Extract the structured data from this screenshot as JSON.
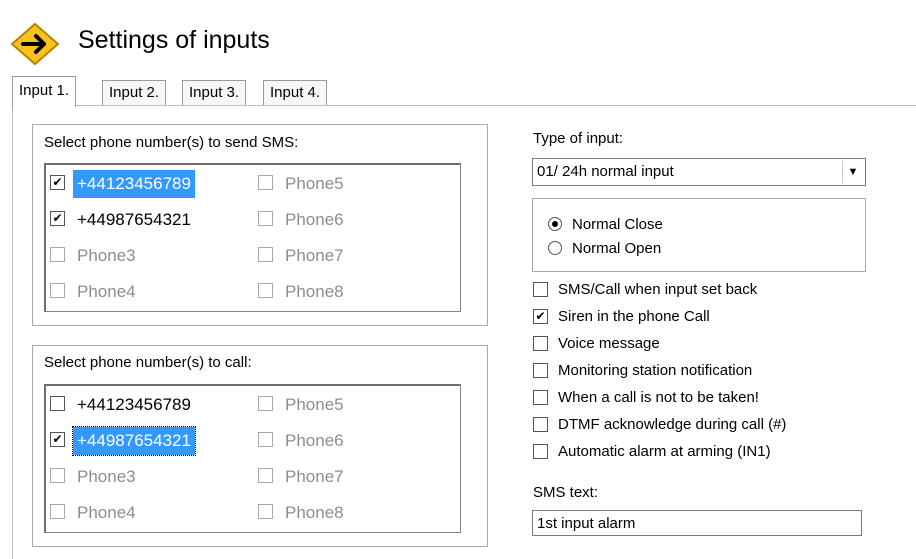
{
  "header": {
    "title": "Settings of inputs",
    "icon": "arrow-right-icon"
  },
  "tabs": [
    {
      "label": "Input 1.",
      "active": true
    },
    {
      "label": "Input 2.",
      "active": false
    },
    {
      "label": "Input 3.",
      "active": false
    },
    {
      "label": "Input 4.",
      "active": false
    }
  ],
  "sms_group": {
    "label": "Select phone number(s) to send SMS:",
    "items": [
      {
        "label": "+44123456789",
        "checked": true,
        "enabled": true,
        "selected": true
      },
      {
        "label": "+44987654321",
        "checked": true,
        "enabled": true
      },
      {
        "label": "Phone3",
        "checked": false,
        "enabled": false
      },
      {
        "label": "Phone4",
        "checked": false,
        "enabled": false
      },
      {
        "label": "Phone5",
        "checked": false,
        "enabled": false
      },
      {
        "label": "Phone6",
        "checked": false,
        "enabled": false
      },
      {
        "label": "Phone7",
        "checked": false,
        "enabled": false
      },
      {
        "label": "Phone8",
        "checked": false,
        "enabled": false
      }
    ]
  },
  "call_group": {
    "label": "Select phone number(s) to call:",
    "items": [
      {
        "label": "+44123456789",
        "checked": false,
        "enabled": true
      },
      {
        "label": "+44987654321",
        "checked": true,
        "enabled": true,
        "selected": true
      },
      {
        "label": "Phone3",
        "checked": false,
        "enabled": false
      },
      {
        "label": "Phone4",
        "checked": false,
        "enabled": false
      },
      {
        "label": "Phone5",
        "checked": false,
        "enabled": false
      },
      {
        "label": "Phone6",
        "checked": false,
        "enabled": false
      },
      {
        "label": "Phone7",
        "checked": false,
        "enabled": false
      },
      {
        "label": "Phone8",
        "checked": false,
        "enabled": false
      }
    ]
  },
  "type_of_input": {
    "label": "Type of input:",
    "value": "01/ 24h normal input",
    "radios": [
      {
        "label": "Normal Close",
        "checked": true
      },
      {
        "label": "Normal Open",
        "checked": false
      }
    ]
  },
  "options": [
    {
      "label": "SMS/Call when input set back",
      "checked": false
    },
    {
      "label": "Siren in the phone Call",
      "checked": true
    },
    {
      "label": "Voice message",
      "checked": false
    },
    {
      "label": "Monitoring station notification",
      "checked": false
    },
    {
      "label": "When a call is not to be taken!",
      "checked": false
    },
    {
      "label": "DTMF acknowledge during call (#)",
      "checked": false
    },
    {
      "label": "Automatic alarm at arming (IN1)",
      "checked": false
    }
  ],
  "sms_text": {
    "label": "SMS text:",
    "value": "1st input alarm"
  },
  "colors": {
    "selection": "#3399ff",
    "logo_fill": "#f6c31c",
    "logo_border": "#c78d00"
  }
}
